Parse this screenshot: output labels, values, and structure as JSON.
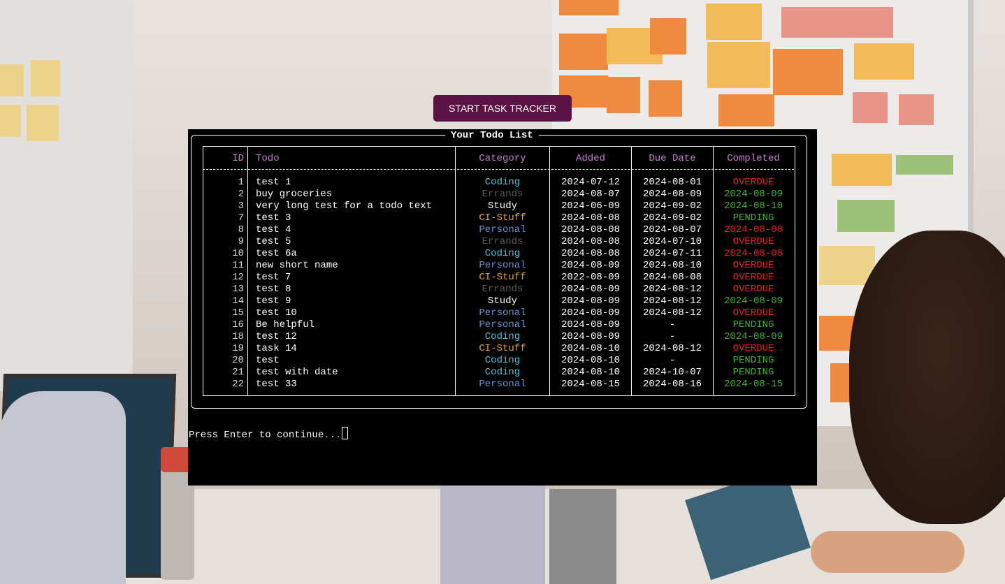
{
  "start_button": {
    "label": "START TASK TRACKER",
    "color": "#5b1345"
  },
  "terminal": {
    "title": "Your Todo List",
    "headers": [
      "ID",
      "Todo",
      "Category",
      "Added",
      "Due Date",
      "Completed"
    ],
    "rows": [
      {
        "id": "1",
        "todo": "test 1",
        "category": "Coding",
        "added": "2024-07-12",
        "due": "2024-08-01",
        "completed": "OVERDUE"
      },
      {
        "id": "2",
        "todo": "buy groceries",
        "category": "Errands",
        "added": "2024-08-07",
        "due": "2024-08-09",
        "completed": "2024-08-09"
      },
      {
        "id": "3",
        "todo": "very long test for a todo text",
        "category": "Study",
        "added": "2024-06-09",
        "due": "2024-09-02",
        "completed": "2024-08-10"
      },
      {
        "id": "7",
        "todo": "test 3",
        "category": "CI-Stuff",
        "added": "2024-08-08",
        "due": "2024-09-02",
        "completed": "PENDING"
      },
      {
        "id": "8",
        "todo": "test 4",
        "category": "Personal",
        "added": "2024-08-08",
        "due": "2024-08-07",
        "completed": "2024-08-08"
      },
      {
        "id": "9",
        "todo": "test 5",
        "category": "Errands",
        "added": "2024-08-08",
        "due": "2024-07-10",
        "completed": "OVERDUE"
      },
      {
        "id": "10",
        "todo": "test 6a",
        "category": "Coding",
        "added": "2024-08-08",
        "due": "2024-07-11",
        "completed": "2024-08-08"
      },
      {
        "id": "11",
        "todo": "new short name",
        "category": "Personal",
        "added": "2024-08-09",
        "due": "2024-08-10",
        "completed": "OVERDUE"
      },
      {
        "id": "12",
        "todo": "test 7",
        "category": "CI-Stuff",
        "added": "2022-08-09",
        "due": "2024-08-08",
        "completed": "OVERDUE"
      },
      {
        "id": "13",
        "todo": "test 8",
        "category": "Errands",
        "added": "2024-08-09",
        "due": "2024-08-12",
        "completed": "OVERDUE"
      },
      {
        "id": "14",
        "todo": "test 9",
        "category": "Study",
        "added": "2024-08-09",
        "due": "2024-08-12",
        "completed": "2024-08-09"
      },
      {
        "id": "15",
        "todo": "test 10",
        "category": "Personal",
        "added": "2024-08-09",
        "due": "2024-08-12",
        "completed": "OVERDUE"
      },
      {
        "id": "16",
        "todo": "Be helpful",
        "category": "Personal",
        "added": "2024-08-09",
        "due": "-",
        "completed": "PENDING"
      },
      {
        "id": "18",
        "todo": "test 12",
        "category": "Coding",
        "added": "2024-08-09",
        "due": "-",
        "completed": "2024-08-09"
      },
      {
        "id": "19",
        "todo": "task 14",
        "category": "CI-Stuff",
        "added": "2024-08-10",
        "due": "2024-08-12",
        "completed": "OVERDUE"
      },
      {
        "id": "20",
        "todo": "test",
        "category": "Coding",
        "added": "2024-08-10",
        "due": "-",
        "completed": "PENDING"
      },
      {
        "id": "21",
        "todo": "test with date",
        "category": "Coding",
        "added": "2024-08-10",
        "due": "2024-10-07",
        "completed": "PENDING"
      },
      {
        "id": "22",
        "todo": "test 33",
        "category": "Personal",
        "added": "2024-08-15",
        "due": "2024-08-16",
        "completed": "2024-08-15"
      }
    ],
    "prompt": "Press Enter to continue",
    "prompt_dots": "..."
  },
  "colors": {
    "header": "#c87fd1",
    "coding": "#44c6d6",
    "errands": "#5a5a5a",
    "study": "#ffffff",
    "ci_stuff": "#e6a02a",
    "personal": "#6f8fd6",
    "overdue": "#e22020",
    "done_on_time": "#3fae2c",
    "done_late": "#e22020",
    "pending": "#3fae2c"
  }
}
